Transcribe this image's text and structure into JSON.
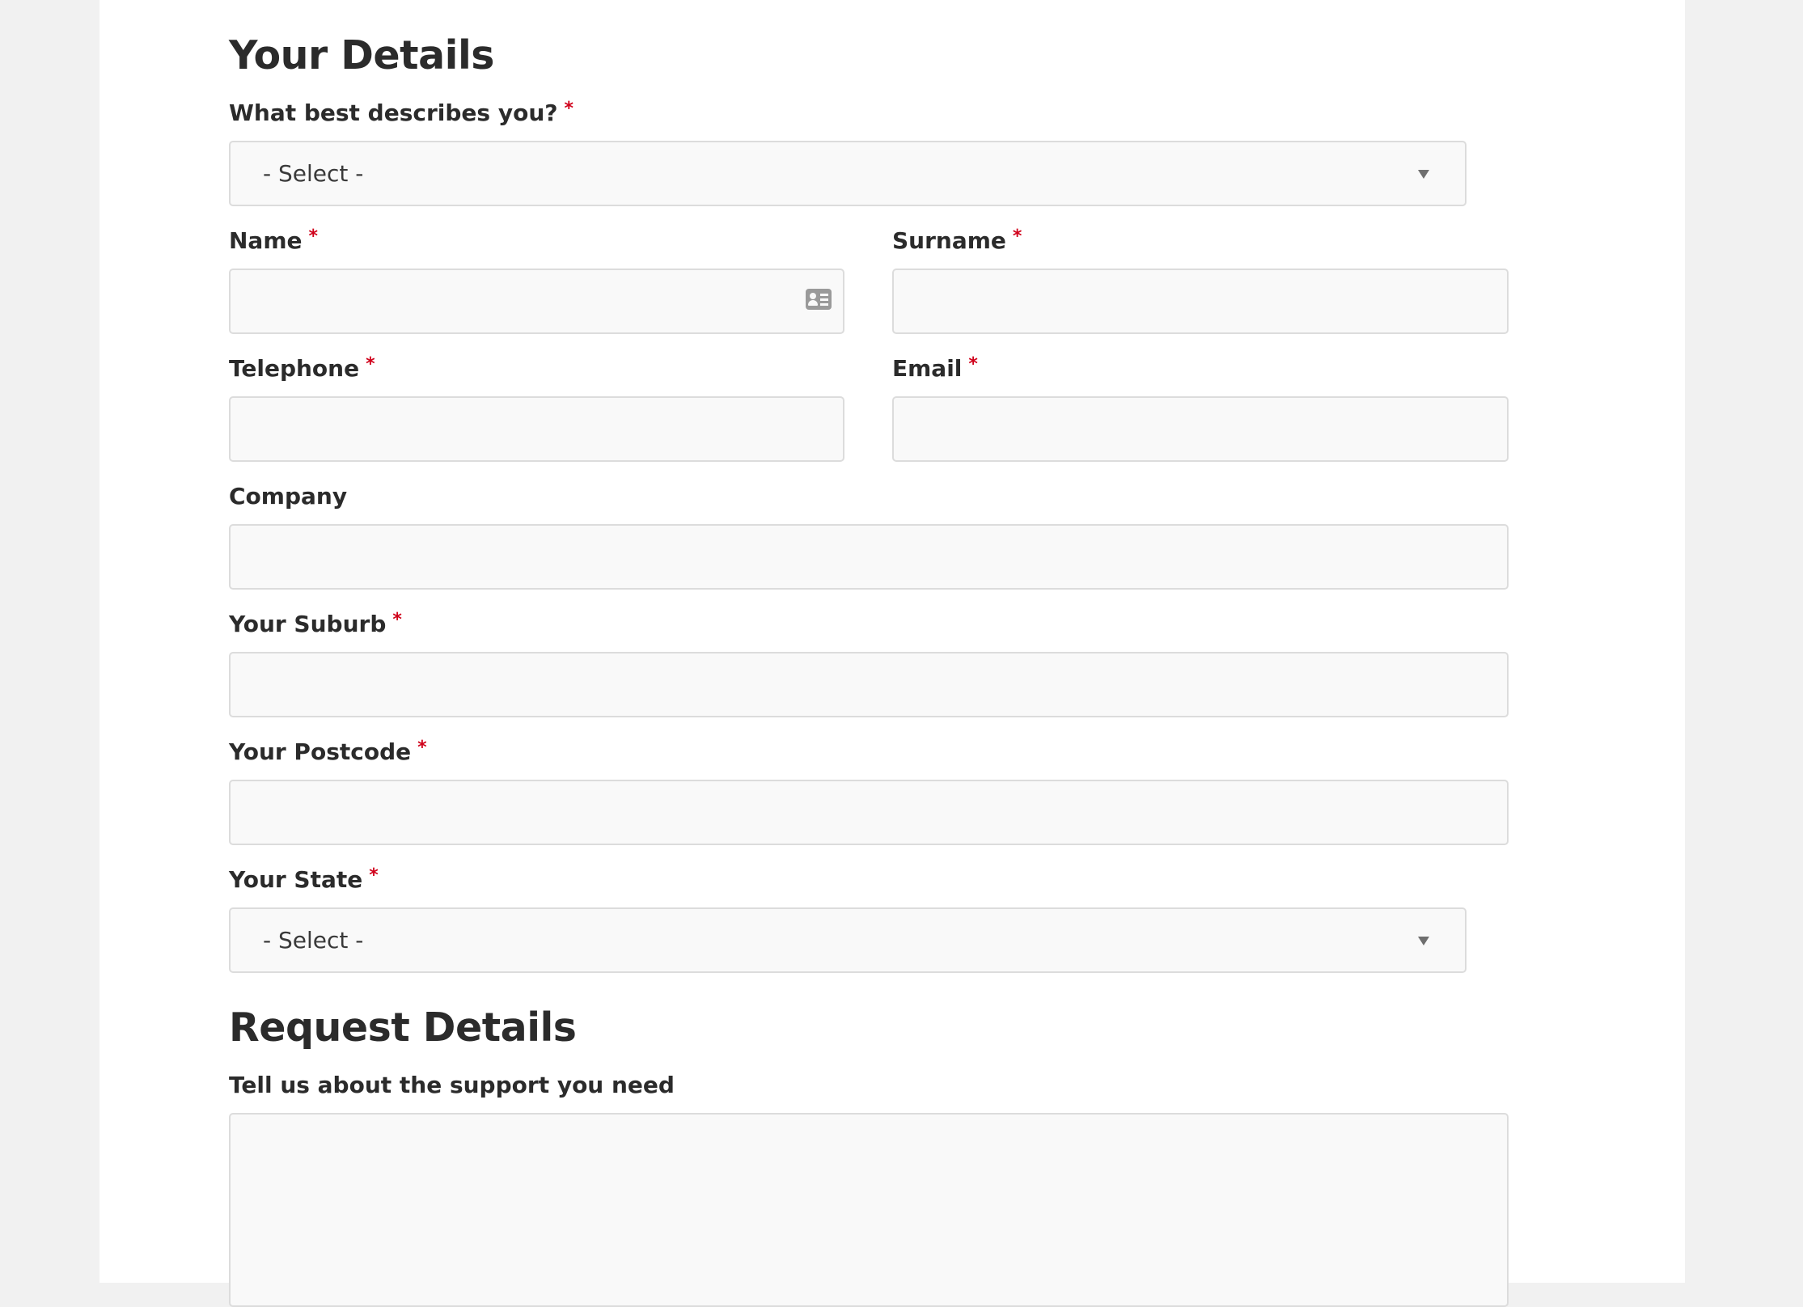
{
  "your_details": {
    "title": "Your Details",
    "describes": {
      "label": "What best describes you?",
      "required": "*",
      "value": "- Select -"
    },
    "name": {
      "label": "Name",
      "required": "*",
      "value": ""
    },
    "surname": {
      "label": "Surname",
      "required": "*",
      "value": ""
    },
    "telephone": {
      "label": "Telephone",
      "required": "*",
      "value": ""
    },
    "email": {
      "label": "Email",
      "required": "*",
      "value": ""
    },
    "company": {
      "label": "Company",
      "value": ""
    },
    "suburb": {
      "label": "Your Suburb",
      "required": "*",
      "value": ""
    },
    "postcode": {
      "label": "Your Postcode",
      "required": "*",
      "value": ""
    },
    "state": {
      "label": "Your State",
      "required": "*",
      "value": "- Select -"
    }
  },
  "request_details": {
    "title": "Request Details",
    "support": {
      "label": "Tell us about the support you need",
      "value": ""
    }
  },
  "icons": {
    "dropdown": "caret-down-icon",
    "name_field": "contact-card-icon"
  },
  "colors": {
    "required_asterisk": "#d0021b",
    "field_background": "#f9f9f9",
    "field_border": "#dcdcdc",
    "page_background": "#f1f1f1",
    "card_background": "#ffffff",
    "text": "#2b2b2b"
  }
}
